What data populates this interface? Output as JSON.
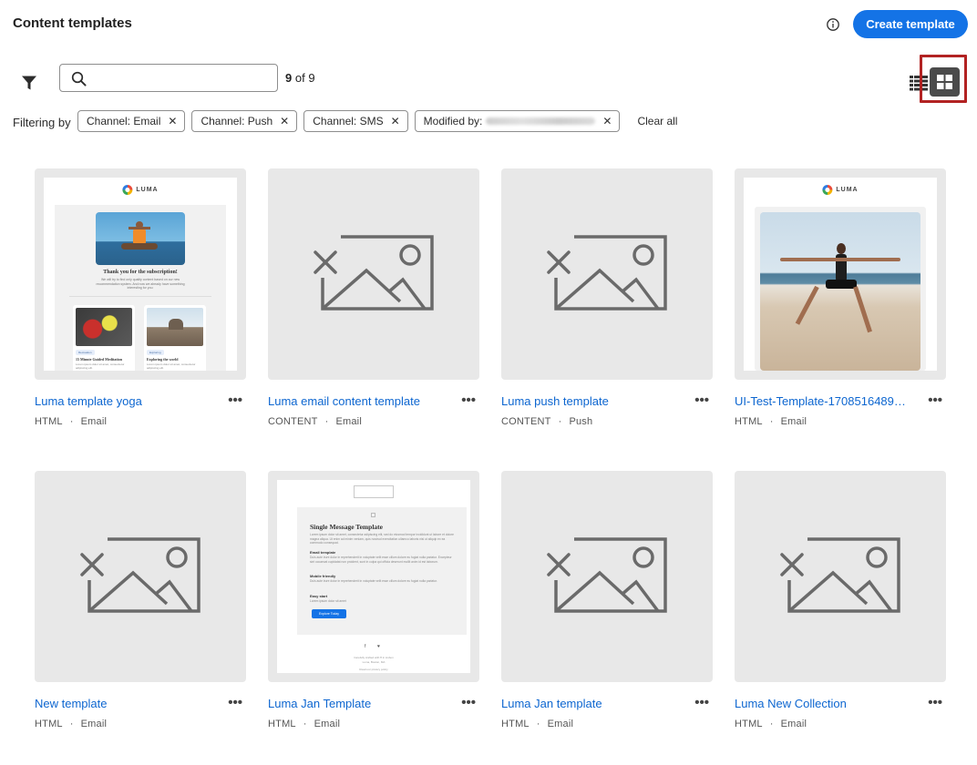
{
  "header": {
    "title": "Content templates",
    "create_button": "Create template"
  },
  "toolbar": {
    "search_placeholder": "",
    "count_shown": "9",
    "count_of": "of 9"
  },
  "filters": {
    "label": "Filtering by",
    "chips": [
      "Channel: Email",
      "Channel: Push",
      "Channel: SMS",
      "Modified by:"
    ],
    "clear_all": "Clear all"
  },
  "cards": [
    {
      "name": "Luma template yoga",
      "type": "HTML",
      "channel": "Email"
    },
    {
      "name": "Luma email content template",
      "type": "CONTENT",
      "channel": "Email"
    },
    {
      "name": "Luma push template",
      "type": "CONTENT",
      "channel": "Push"
    },
    {
      "name": "UI-Test-Template-170851648906...",
      "type": "HTML",
      "channel": "Email"
    },
    {
      "name": "New template",
      "type": "HTML",
      "channel": "Email"
    },
    {
      "name": "Luma Jan Template",
      "type": "HTML",
      "channel": "Email"
    },
    {
      "name": "Luma Jan template",
      "type": "HTML",
      "channel": "Email"
    },
    {
      "name": "Luma New Collection",
      "type": "HTML",
      "channel": "Email"
    }
  ],
  "previews": {
    "luma_brand": "LUMA",
    "yoga_heading": "Thank you for the subscription!",
    "yoga_body": "We will try to find only quality content based on our new recommendation system. And now we already have something interesting for you:",
    "yoga_tag_1": "Recreation",
    "yoga_card_1": "15 Minute Guided Meditation",
    "yoga_tag_2": "Exploring",
    "yoga_card_2": "Exploring the world",
    "yoga_lorem": "Lorem ipsum dolor sit amet, consectetur adipiscing elit.",
    "single_title": "Single Message Template",
    "single_body": "Lorem ipsum dolor sit amet, consectetur adipiscing elit, sed do eiusmod tempor incididunt ut labore et dolore magna aliqua. Ut enim ad minim veniam, quis nostrud exercitation ullamco laboris nisi ut aliquip ex ea commodo consequat.",
    "single_h1": "Email template",
    "single_p1": "Duis aute irure dolor in reprehenderit in voluptate velit esse cillum dolore eu fugiat nulla pariatur. Excepteur sint occaecat cupidatat non proident, sunt in culpa qui officia deserunt mollit anim id est laborum.",
    "single_h2": "Mobile friendly",
    "single_p2": "Duis aute irure dolor in reprehenderit in voluptate velit esse cillum dolore eu fugiat nulla pariatur.",
    "single_h3": "Easy start",
    "single_p3": "Lorem ipsum dolor sit amet",
    "single_cta": "Explore Today",
    "single_footer": "Carefully crafted with ♥ in Lisbon",
    "single_footer2": "Luma, Boston, MA",
    "single_footer3": "Read our privacy policy"
  },
  "colors": {
    "accent": "#1473e6",
    "link": "#0d66d0",
    "highlight": "#b22222",
    "thumb_bg": "#e8e8e8"
  }
}
